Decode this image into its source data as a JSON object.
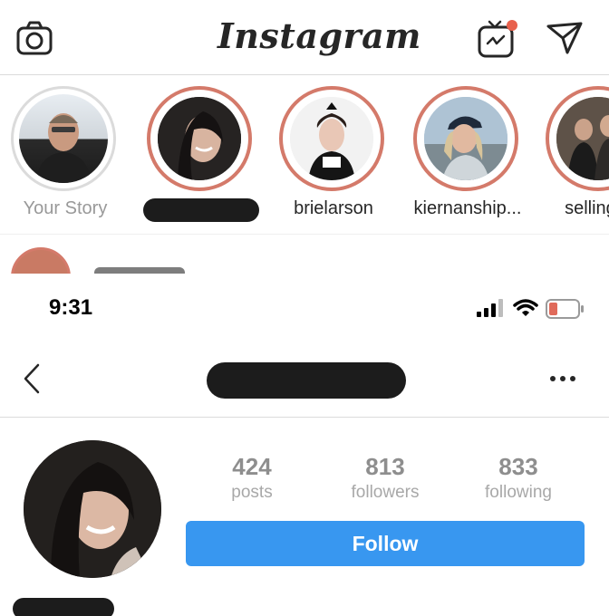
{
  "feed": {
    "app_title": "Instagram",
    "icons": {
      "camera": "camera-icon",
      "igtv": "igtv-icon",
      "direct": "paper-plane-icon"
    },
    "stories": [
      {
        "label": "Your Story",
        "own": true
      },
      {
        "label": "",
        "redacted": true
      },
      {
        "label": "brielarson"
      },
      {
        "label": "kiernanship..."
      },
      {
        "label": "selling_k"
      }
    ]
  },
  "profile": {
    "status": {
      "time": "9:31"
    },
    "nav": {
      "back_icon": "chevron-left-icon",
      "more_icon": "more-icon"
    },
    "stats": [
      {
        "value": "424",
        "label": "posts"
      },
      {
        "value": "813",
        "label": "followers"
      },
      {
        "value": "833",
        "label": "following"
      }
    ],
    "follow_label": "Follow"
  },
  "colors": {
    "accent": "#3897f0",
    "story_ring": "#d47a6a",
    "notification_dot": "#e8614d",
    "battery_low": "#e06a5a"
  }
}
